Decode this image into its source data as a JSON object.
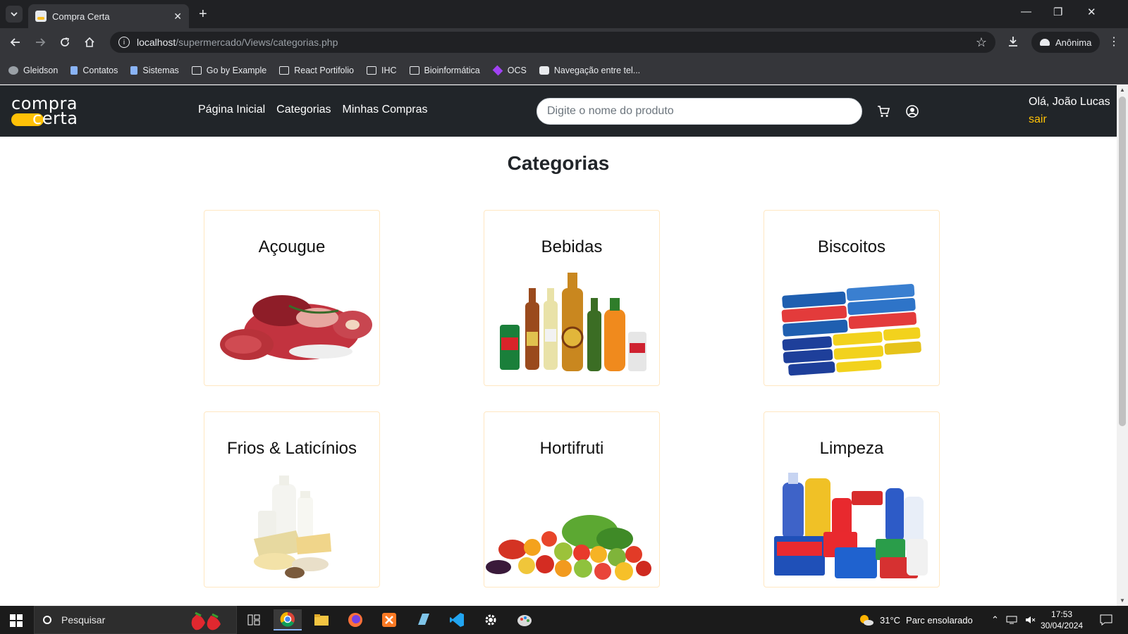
{
  "browser": {
    "tab_title": "Compra Certa",
    "tab_close": "✕",
    "new_tab": "+",
    "window_minimize": "—",
    "window_restore": "❐",
    "window_close": "✕",
    "url_host": "localhost",
    "url_path": "/supermercado/Views/categorias.php",
    "profile_label": "Anônima",
    "bookmarks": [
      {
        "label": "Gleidson",
        "icon": "globe"
      },
      {
        "label": "Contatos",
        "icon": "doc"
      },
      {
        "label": "Sistemas",
        "icon": "doc"
      },
      {
        "label": "Go by Example",
        "icon": "code"
      },
      {
        "label": "React Portifolio",
        "icon": "folder"
      },
      {
        "label": "IHC",
        "icon": "folder"
      },
      {
        "label": "Bioinformática",
        "icon": "folder"
      },
      {
        "label": "OCS",
        "icon": "ocs"
      },
      {
        "label": "Navegação entre tel...",
        "icon": "nav"
      }
    ]
  },
  "site": {
    "logo_top": "compra",
    "logo_bottom": "certa",
    "nav": [
      "Página Inicial",
      "Categorias",
      "Minhas Compras"
    ],
    "search_placeholder": "Digite o nome do produto",
    "greeting": "Olá, João Lucas",
    "logout": "sair"
  },
  "page": {
    "title": "Categorias",
    "categories": [
      {
        "name": "Açougue"
      },
      {
        "name": "Bebidas"
      },
      {
        "name": "Biscoitos"
      },
      {
        "name": "Frios & Laticínios"
      },
      {
        "name": "Hortifruti"
      },
      {
        "name": "Limpeza"
      }
    ]
  },
  "taskbar": {
    "search_label": "Pesquisar",
    "weather_temp": "31°C",
    "weather_text": "Parc ensolarado",
    "time": "17:53",
    "date": "30/04/2024"
  },
  "colors": {
    "accent": "#ffc107",
    "navbar": "#212529",
    "card_border": "#ffe7c2"
  }
}
